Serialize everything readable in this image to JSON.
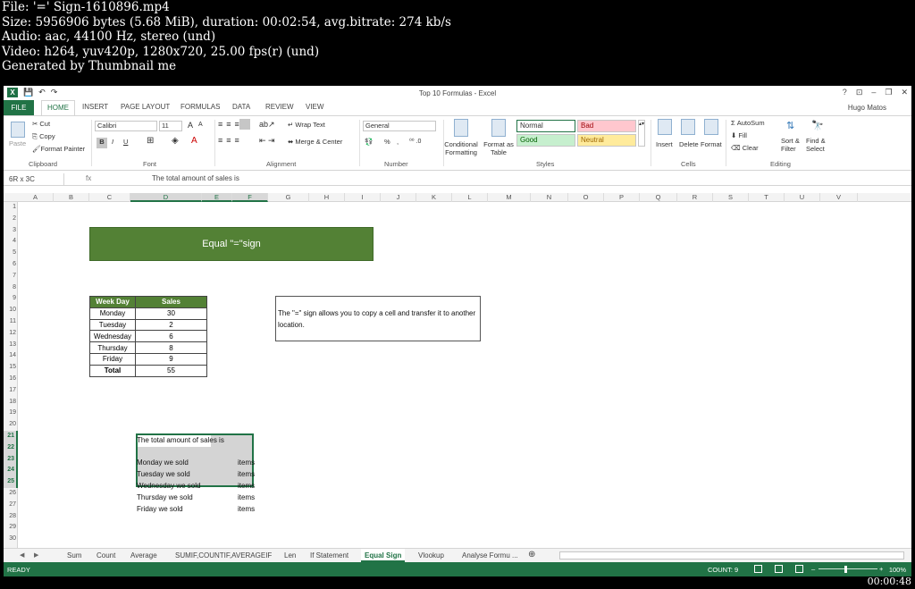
{
  "meta": {
    "file": "File: '=' Sign-1610896.mp4",
    "size": "Size: 5956906 bytes (5.68 MiB), duration: 00:02:54, avg.bitrate: 274 kb/s",
    "audio": "Audio: aac, 44100 Hz, stereo (und)",
    "video": "Video: h264, yuv420p, 1280x720, 25.00 fps(r) (und)",
    "generated": "Generated by Thumbnail me"
  },
  "timestamp": "00:00:48",
  "window": {
    "title": "Top 10 Formulas - Excel",
    "user": "Hugo Matos"
  },
  "qat": {
    "logo": "X",
    "save": "💾",
    "undo": "↶",
    "redo": "↷"
  },
  "winctrl": {
    "help": "?",
    "ribbon_opts": "⊡",
    "min": "–",
    "restore": "❐",
    "close": "✕"
  },
  "ribbon_tabs": [
    "FILE",
    "HOME",
    "INSERT",
    "PAGE LAYOUT",
    "FORMULAS",
    "DATA",
    "REVIEW",
    "VIEW"
  ],
  "clipboard": {
    "paste": "Paste",
    "cut": "Cut",
    "copy": "Copy",
    "format_painter": "Format Painter",
    "label": "Clipboard"
  },
  "font": {
    "name": "Calibri",
    "size": "11",
    "bold": "B",
    "italic": "I",
    "underline": "U",
    "grow": "A",
    "shrink": "A",
    "label": "Font"
  },
  "alignment": {
    "wrap": "Wrap Text",
    "merge": "Merge & Center",
    "label": "Alignment"
  },
  "number": {
    "format": "General",
    "percent": "%",
    "comma": ",",
    "label": "Number"
  },
  "styles": {
    "cond_format": "Conditional Formatting",
    "format_table": "Format as Table",
    "normal": "Normal",
    "bad": "Bad",
    "good": "Good",
    "neutral": "Neutral",
    "label": "Styles"
  },
  "cells": {
    "insert": "Insert",
    "delete": "Delete",
    "format": "Format",
    "label": "Cells"
  },
  "editing": {
    "autosum": "AutoSum",
    "fill": "Fill",
    "clear": "Clear",
    "sort": "Sort & Filter",
    "find": "Find & Select",
    "label": "Editing"
  },
  "formula_bar": {
    "name_box": "6R x 3C",
    "fx": "fx",
    "value": "The total amount of sales is"
  },
  "columns": [
    "A",
    "B",
    "C",
    "D",
    "E",
    "F",
    "G",
    "H",
    "I",
    "J",
    "K",
    "L",
    "M",
    "N",
    "O",
    "P",
    "Q",
    "R",
    "S",
    "T",
    "U",
    "V"
  ],
  "rows": [
    "1",
    "2",
    "3",
    "4",
    "5",
    "6",
    "7",
    "8",
    "9",
    "10",
    "11",
    "12",
    "13",
    "14",
    "15",
    "16",
    "17",
    "18",
    "19",
    "20",
    "21",
    "22",
    "23",
    "24",
    "25",
    "26",
    "27",
    "28",
    "29",
    "30"
  ],
  "banner": "Equal \"=\"sign",
  "table": {
    "headers": [
      "Week Day",
      "Sales"
    ],
    "rows": [
      [
        "Monday",
        "30"
      ],
      [
        "Tuesday",
        "2"
      ],
      [
        "Wednesday",
        "6"
      ],
      [
        "Thursday",
        "8"
      ],
      [
        "Friday",
        "9"
      ]
    ],
    "total": [
      "Total",
      "55"
    ]
  },
  "note": "The \"=\" sign allows you to copy a cell and transfer it to another location.",
  "sheet_text": {
    "r21": "The total amount of sales is",
    "r23": "Monday we sold",
    "r24": "Tuesday we sold",
    "r25": "Wednesday we sold",
    "r26": "Thursday we sold",
    "r27": "Friday we sold",
    "items": "items"
  },
  "sheet_tabs": [
    "Sum",
    "Count",
    "Average",
    "SUMIF,COUNTIF,AVERAGEIF",
    "Len",
    "If Statement",
    "Equal Sign",
    "Vlookup",
    "Analyse Formu ..."
  ],
  "sheet_nav": {
    "prev": "◀",
    "next": "▶",
    "add": "⊕"
  },
  "status": {
    "ready": "READY",
    "count": "COUNT: 9",
    "zoom": "100%",
    "minus": "–",
    "plus": "+"
  }
}
